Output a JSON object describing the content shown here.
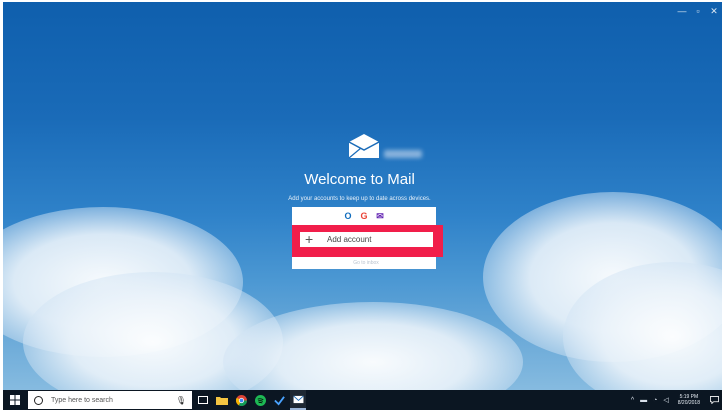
{
  "window": {
    "minimize_glyph": "—",
    "maximize_glyph": "▫",
    "close_glyph": "✕"
  },
  "welcome": {
    "title": "Welcome to Mail",
    "subtitle": "Add your accounts to keep up to date across devices.",
    "add_account_label": "Add account",
    "ready_link": "Go to inbox"
  },
  "services": [
    {
      "name": "outlook-icon",
      "glyph": "O",
      "color": "#0f6cbd"
    },
    {
      "name": "google-icon",
      "glyph": "G",
      "color": "#ea4335"
    },
    {
      "name": "yahoo-icon",
      "glyph": "✉",
      "color": "#5f1fb0"
    }
  ],
  "taskbar": {
    "search_placeholder": "Type here to search",
    "time": "5:19 PM",
    "date": "8/20/2018"
  },
  "colors": {
    "highlight": "#f11e4a",
    "taskbar": "#0b1622",
    "sky_top": "#0f5fad"
  }
}
